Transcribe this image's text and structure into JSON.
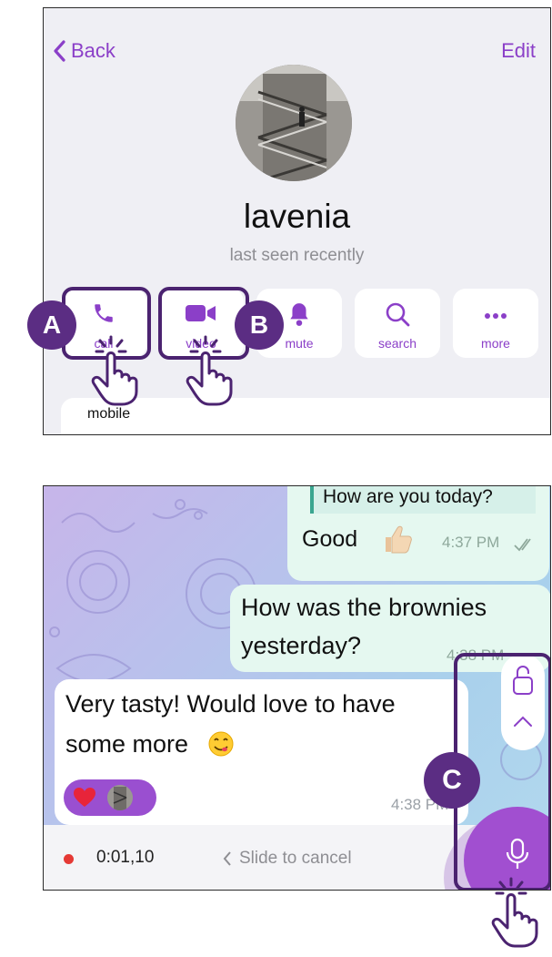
{
  "profile": {
    "back_label": "Back",
    "edit_label": "Edit",
    "name": "lavenia",
    "status": "last seen recently",
    "actions": [
      {
        "label": "call",
        "icon": "phone-icon"
      },
      {
        "label": "video",
        "icon": "video-camera-icon"
      },
      {
        "label": "mute",
        "icon": "bell-icon"
      },
      {
        "label": "search",
        "icon": "search-icon"
      },
      {
        "label": "more",
        "icon": "more-dots-icon"
      }
    ],
    "phone_label": "mobile"
  },
  "callouts": {
    "a": "A",
    "b": "B",
    "c": "C"
  },
  "chat": {
    "messages": [
      {
        "direction": "outgoing",
        "reply_quote": "How are you today?",
        "text": "Good",
        "emoji": "thumbs-up-icon",
        "time": "4:37 PM",
        "read": true
      },
      {
        "direction": "outgoing",
        "text_line1": "How was the brownies",
        "text_line2": "yesterday?",
        "time": "4:38 PM"
      },
      {
        "direction": "incoming",
        "text_line1": "Very tasty! Would love to have",
        "text_line2": "some more",
        "emoji": "yum-face-icon",
        "time": "4:38 PM",
        "reactions": [
          "heart-icon",
          "avatar"
        ]
      }
    ],
    "recording": {
      "time": "0:01,10",
      "slide_hint": "Slide to cancel"
    }
  },
  "colors": {
    "accent": "#8b3fc8",
    "callout": "#5b2d83",
    "outgoing_bubble": "#e5f8f0",
    "record_dot": "#e53935"
  }
}
